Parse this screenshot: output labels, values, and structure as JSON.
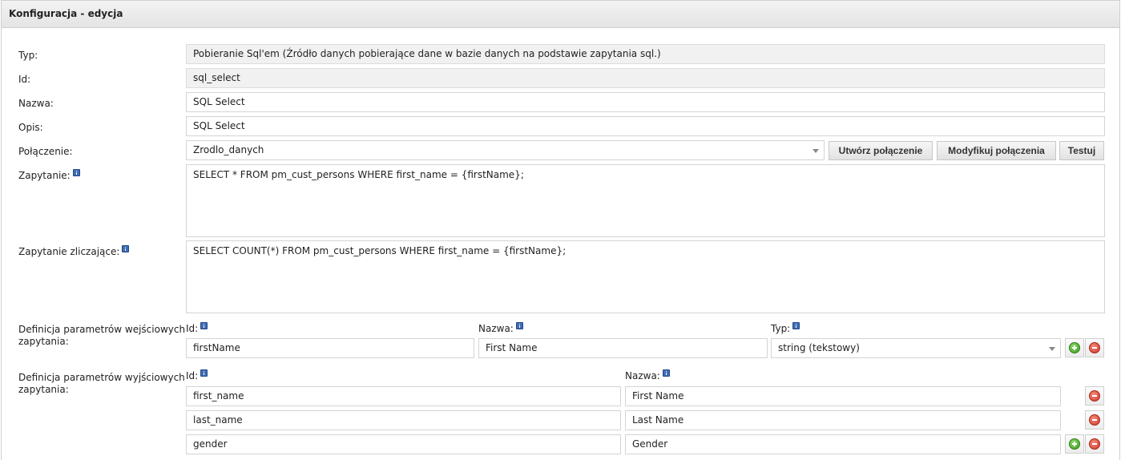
{
  "panel": {
    "title": "Konfiguracja - edycja"
  },
  "form": {
    "typ": {
      "label": "Typ:",
      "value": "Pobieranie Sql'em (Źródło danych pobierające dane w bazie danych na podstawie zapytania sql.)"
    },
    "id": {
      "label": "Id:",
      "value": "sql_select"
    },
    "nazwa": {
      "label": "Nazwa:",
      "value": "SQL Select"
    },
    "opis": {
      "label": "Opis:",
      "value": "SQL Select"
    },
    "polaczenie": {
      "label": "Połączenie:",
      "value": "Zrodlo_danych",
      "create_label": "Utwórz połączenie",
      "modify_label": "Modyfikuj połączenia",
      "test_label": "Testuj"
    },
    "zapytanie": {
      "label": "Zapytanie:",
      "value": "SELECT * FROM pm_cust_persons WHERE first_name = {firstName};"
    },
    "zapytanie_zliczajace": {
      "label": "Zapytanie zliczające:",
      "value": "SELECT COUNT(*) FROM pm_cust_persons WHERE first_name = {firstName};"
    }
  },
  "input_params": {
    "label": "Definicja parametrów wejściowych zapytania:",
    "col_id": "Id:",
    "col_name": "Nazwa:",
    "col_type": "Typ:",
    "rows": [
      {
        "id": "firstName",
        "name": "First Name",
        "type": "string (tekstowy)"
      }
    ]
  },
  "output_params": {
    "label": "Definicja parametrów wyjściowych zapytania:",
    "col_id": "Id:",
    "col_name": "Nazwa:",
    "rows": [
      {
        "id": "first_name",
        "name": "First Name"
      },
      {
        "id": "last_name",
        "name": "Last Name"
      },
      {
        "id": "gender",
        "name": "Gender"
      }
    ]
  },
  "icons": {
    "info": "info-icon",
    "add": "add-icon",
    "remove": "remove-icon",
    "dropdown": "chevron-down-icon"
  }
}
